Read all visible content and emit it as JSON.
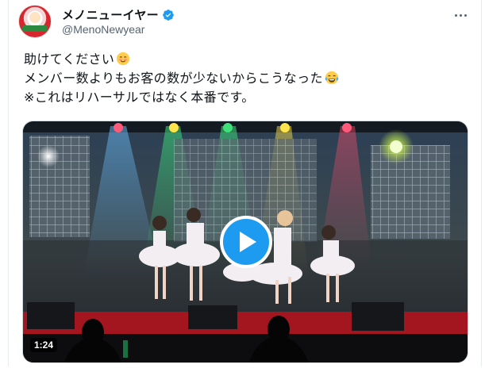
{
  "tweet": {
    "display_name": "メノニューイヤー",
    "handle": "@MenoNewyear",
    "verified_icon": "verified-badge-icon",
    "more_icon": "more-options-icon",
    "text_lines": [
      "助けてください",
      "メンバー数よりもお客の数が少ないからこうなった",
      "※これはリハーサルではなく本番です。"
    ],
    "emojis": [
      "smiling-face-emoji",
      "tears-of-joy-emoji"
    ]
  },
  "media": {
    "type": "video",
    "duration": "1:24",
    "play_icon": "play-icon"
  },
  "colors": {
    "accent": "#1d9bf0",
    "text": "#0f1419",
    "secondary_text": "#536471",
    "stage_floor": "#a3161f"
  }
}
